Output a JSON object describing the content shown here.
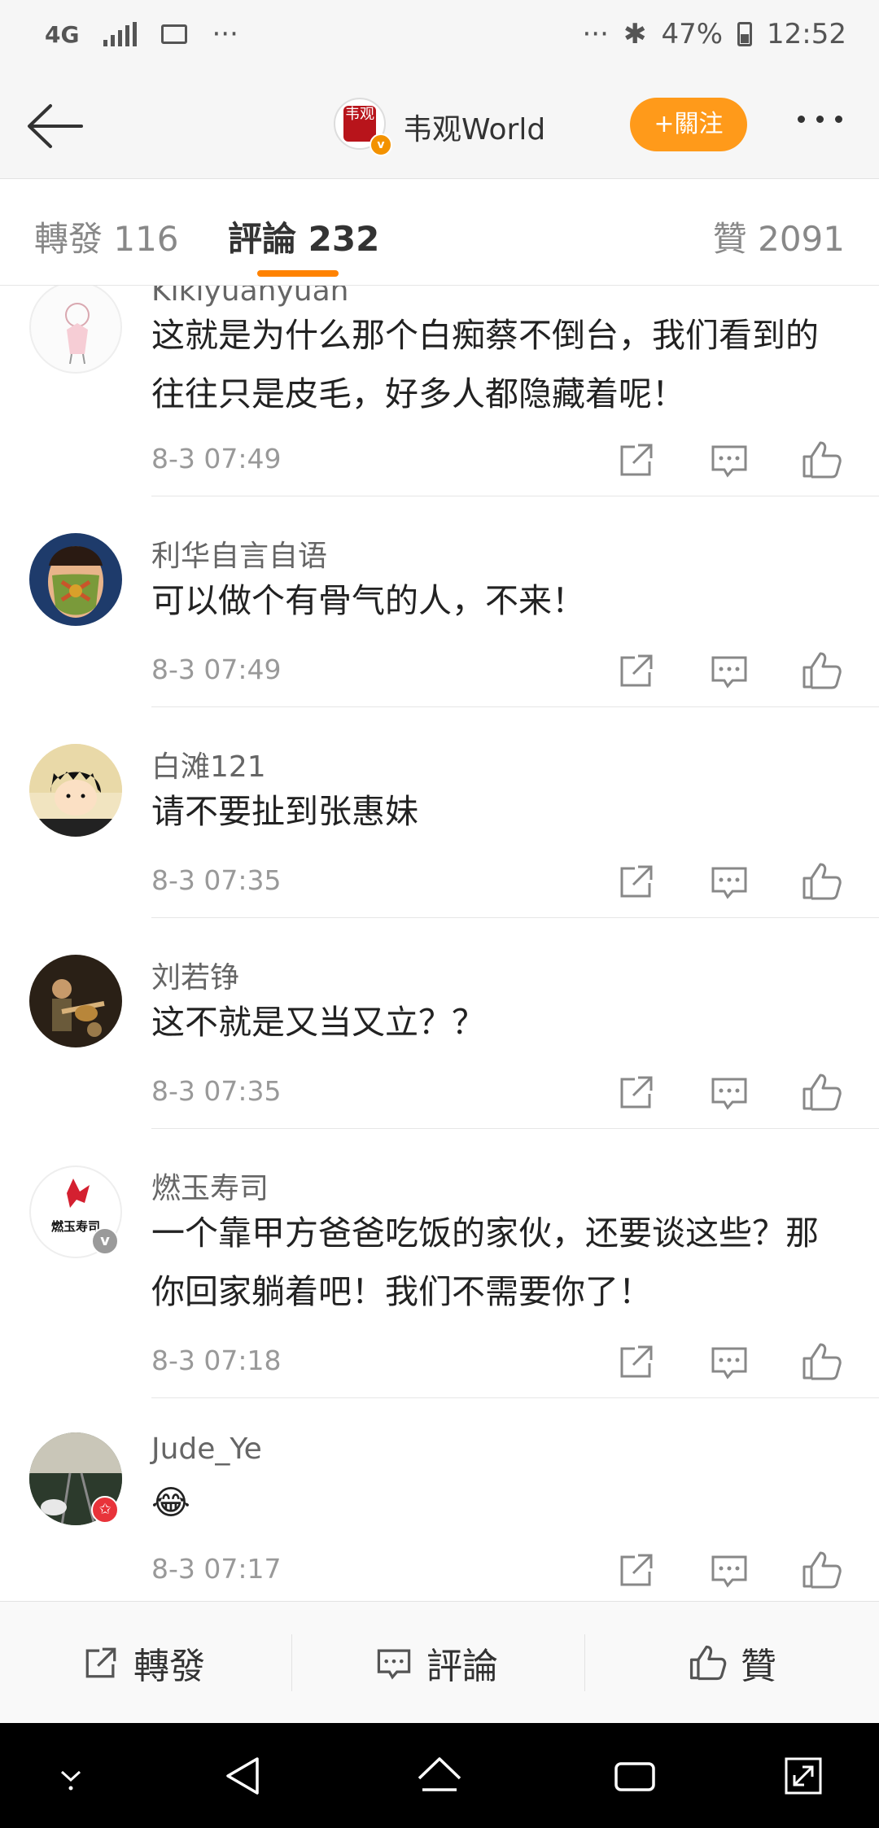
{
  "status_bar": {
    "network": "4G",
    "dots_left": "···",
    "dots_right": "···",
    "bluetooth": "✱",
    "battery": "47%",
    "time": "12:52"
  },
  "header": {
    "title": "韦观World",
    "avatar_seal": "韦观",
    "follow_label": "+關注"
  },
  "tabs": [
    {
      "label": "轉發 116"
    },
    {
      "label": "評論 232"
    },
    {
      "label": "贊 2091"
    }
  ],
  "comments": [
    {
      "user": "Kikiyuanyuan",
      "text": "这就是为什么那个白痴蔡不倒台，我们看到的往往只是皮毛，好多人都隐藏着呢！",
      "time": "8-3 07:49"
    },
    {
      "user": "利华自言自语",
      "text": "可以做个有骨气的人，不来！",
      "time": "8-3 07:49"
    },
    {
      "user": "白滩121",
      "text": "请不要扯到张惠妹",
      "time": "8-3 07:35"
    },
    {
      "user": "刘若铮",
      "text": "这不就是又当又立？？",
      "time": "8-3 07:35"
    },
    {
      "user": "燃玉寿司",
      "text": "一个靠甲方爸爸吃饭的家伙，还要谈这些？那你回家躺着吧！我们不需要你了！",
      "time": "8-3 07:18",
      "avatar_text": "燃玉寿司"
    },
    {
      "user": "Jude_Ye",
      "text": "😂",
      "time": "8-3 07:17"
    }
  ],
  "bottom_bar": {
    "repost_label": "轉發",
    "comment_label": "評論",
    "like_label": "贊"
  },
  "colors": {
    "accent": "#ff8200",
    "follow_bg": "#ff9a1a",
    "verified": "#f39200"
  }
}
